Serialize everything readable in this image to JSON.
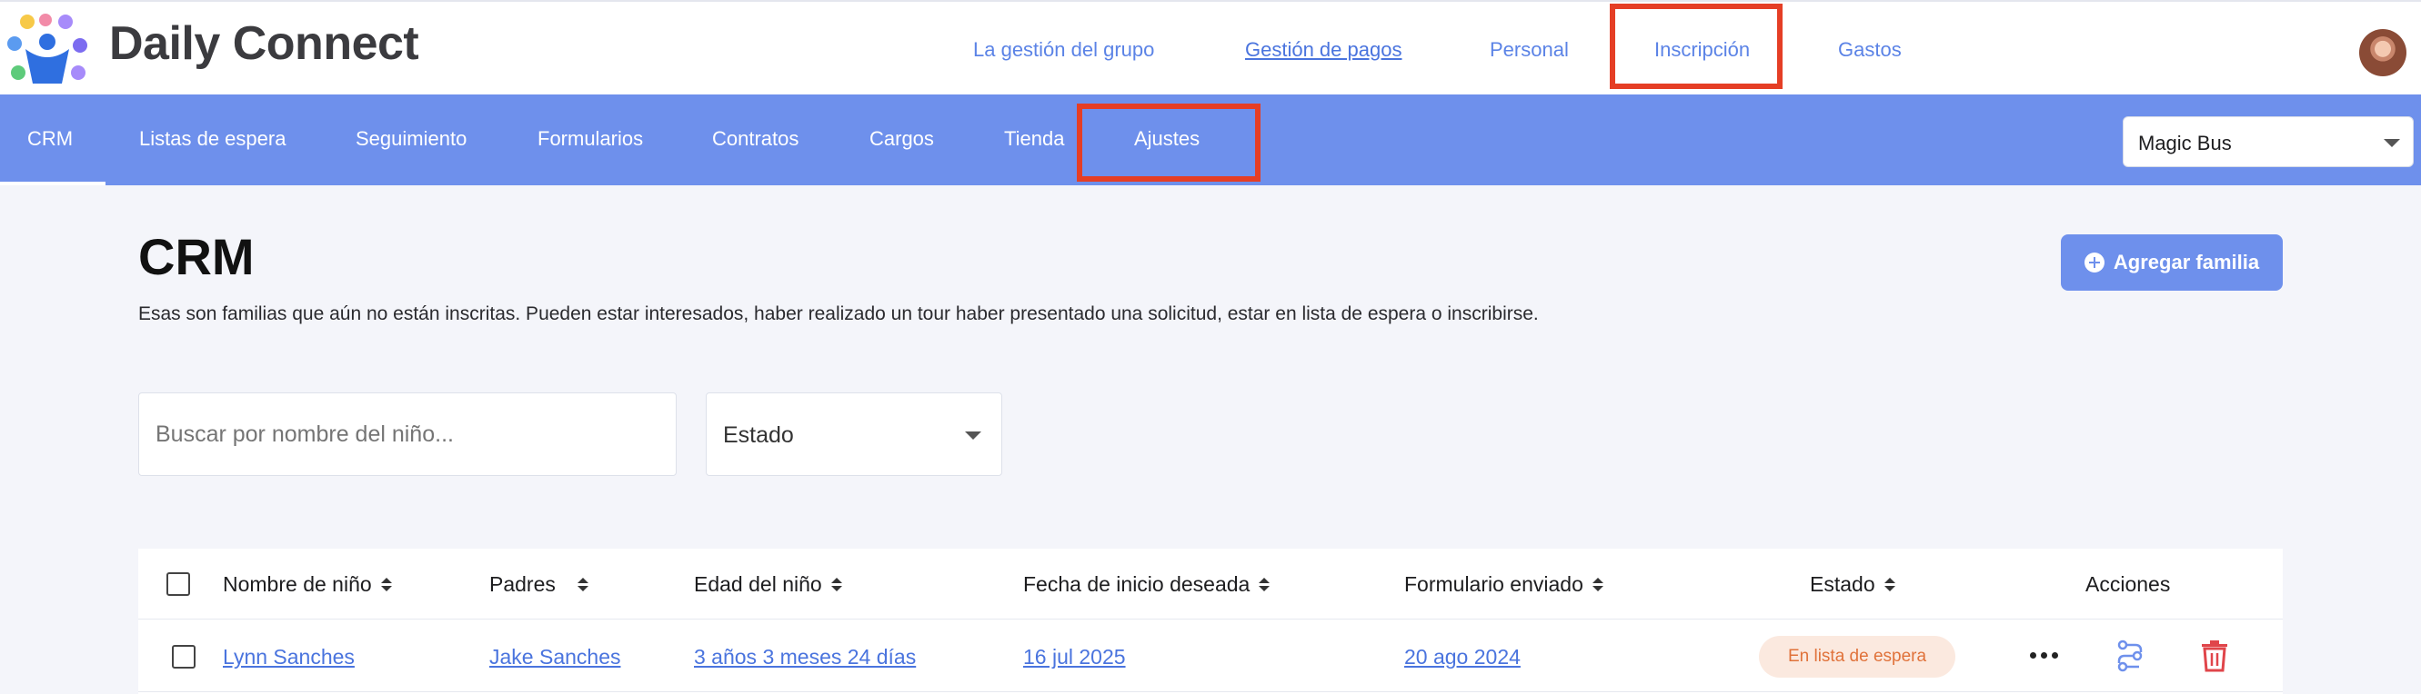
{
  "app": {
    "brand": "Daily Connect"
  },
  "topnav": [
    {
      "label": "La gestión del grupo"
    },
    {
      "label": "Gestión de pagos"
    },
    {
      "label": "Personal"
    },
    {
      "label": "Inscripción"
    },
    {
      "label": "Gastos"
    }
  ],
  "subnav": [
    {
      "label": "CRM"
    },
    {
      "label": "Listas de espera"
    },
    {
      "label": "Seguimiento"
    },
    {
      "label": "Formularios"
    },
    {
      "label": "Contratos"
    },
    {
      "label": "Cargos"
    },
    {
      "label": "Tienda"
    },
    {
      "label": "Ajustes"
    }
  ],
  "location_select": {
    "value": "Magic Bus"
  },
  "page": {
    "title": "CRM",
    "description": "Esas son familias que aún no están inscritas. Pueden estar interesados, haber realizado un tour haber presentado una solicitud, estar en lista de espera o inscribirse.",
    "add_button": "Agregar familia"
  },
  "filters": {
    "search_placeholder": "Buscar por nombre del niño...",
    "status_label": "Estado"
  },
  "table": {
    "columns": [
      "Nombre de niño",
      "Padres",
      "Edad del niño",
      "Fecha de inicio deseada",
      "Formulario enviado",
      "Estado",
      "Acciones"
    ],
    "rows": [
      {
        "child": "Lynn Sanches",
        "parent": "Jake Sanches",
        "age": "3 años 3 meses 24 días",
        "start_date": "16 jul 2025",
        "form_sent": "20 ago 2024",
        "status": "En lista de espera"
      }
    ]
  },
  "colors": {
    "accent": "#6e90ec",
    "link": "#4a74de",
    "highlight": "#e53e25",
    "badge_bg": "#fbe9df",
    "badge_text": "#e0723a",
    "danger": "#e0454a"
  }
}
